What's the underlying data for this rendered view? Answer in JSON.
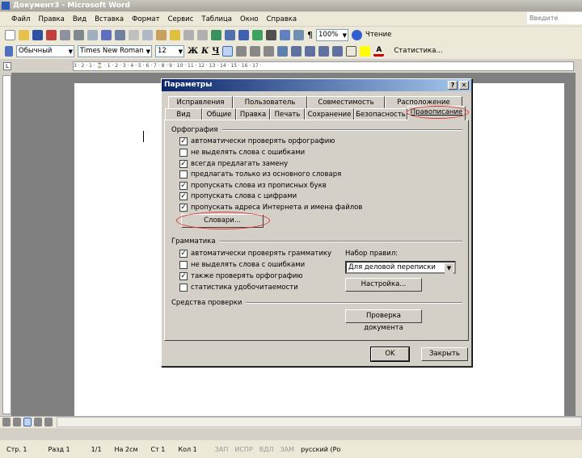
{
  "window": {
    "title": "Документ3 - Microsoft Word"
  },
  "menu": [
    "Файл",
    "Правка",
    "Вид",
    "Вставка",
    "Формат",
    "Сервис",
    "Таблица",
    "Окно",
    "Справка"
  ],
  "help_placeholder": "Введите вопрос",
  "toolbar": {
    "zoom": "100%",
    "reading": "Чтение"
  },
  "format": {
    "style": "Обычный",
    "font": "Times New Roman",
    "size": "12",
    "bold": "Ж",
    "italic": "К",
    "underline": "Ч",
    "stats": "Статистика..."
  },
  "ruler": "3 · 2 · 1 · ⌛ · 1 · 2 · 3 · 4 · 5 · 6 · 7 · 8 · 9 · 10 · 11 · 12 · 13 · 14 · 15 · 16 · 17 ·",
  "dialog": {
    "title": "Параметры",
    "tabs_row1": [
      "Исправления",
      "Пользователь",
      "Совместимость",
      "Расположение"
    ],
    "tabs_row2": [
      "Вид",
      "Общие",
      "Правка",
      "Печать",
      "Сохранение",
      "Безопасность",
      "Правописание"
    ],
    "spelling": {
      "label": "Орфография",
      "options": [
        {
          "label": "автоматически проверять орфографию",
          "checked": true
        },
        {
          "label": "не выделять слова с ошибками",
          "checked": false
        },
        {
          "label": "всегда предлагать замену",
          "checked": true
        },
        {
          "label": "предлагать только из основного словаря",
          "checked": false
        },
        {
          "label": "пропускать слова из прописных букв",
          "checked": true
        },
        {
          "label": "пропускать слова с цифрами",
          "checked": true
        },
        {
          "label": "пропускать адреса Интернета и имена файлов",
          "checked": true
        }
      ],
      "dictionaries": "Словари..."
    },
    "grammar": {
      "label": "Грамматика",
      "options": [
        {
          "label": "автоматически проверять грамматику",
          "checked": true
        },
        {
          "label": "не выделять слова с ошибками",
          "checked": false
        },
        {
          "label": "также проверять орфографию",
          "checked": true
        },
        {
          "label": "статистика удобочитаемости",
          "checked": false
        }
      ],
      "ruleset_label": "Набор правил:",
      "ruleset": "Для деловой переписки",
      "settings": "Настройка..."
    },
    "tools": {
      "label": "Средства проверки",
      "check": "Проверка документа"
    },
    "ok": "OK",
    "close": "Закрыть"
  },
  "status": {
    "page": "Стр. 1",
    "section": "Разд 1",
    "pages": "1/1",
    "at": "На 2см",
    "line": "Ст 1",
    "col": "Кол 1",
    "rec": "ЗАП",
    "trk": "ИСПР",
    "ext": "ВДЛ",
    "ovr": "ЗАМ",
    "lang": "русский (Ро"
  }
}
